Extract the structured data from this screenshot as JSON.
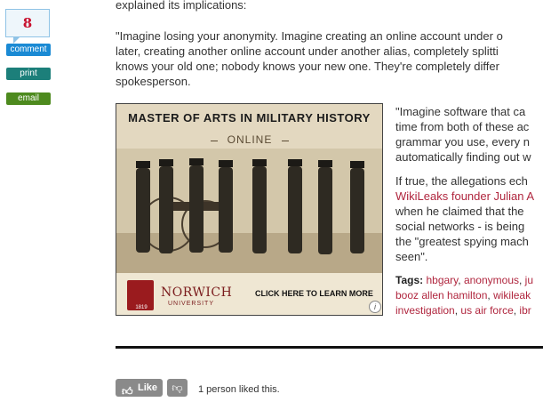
{
  "sidebar": {
    "comment_count": "8",
    "comment_label": "comment",
    "print_label": "print",
    "email_label": "email"
  },
  "article": {
    "intro_fragment": "explained its implications:",
    "quote_lines": [
      "\"Imagine losing your anonymity. Imagine creating an online account under o",
      "later, creating another online account under another alias, completely splitti",
      "knows your old one; nobody knows your new one. They're completely differ",
      "spokesperson."
    ],
    "right_para1": [
      "\"Imagine software that ca",
      "time from both of these ac",
      "grammar you use, every n",
      "automatically finding out w"
    ],
    "right_para2_line1": "If true, the allegations ech",
    "right_para2_link": "WikiLeaks founder Julian A",
    "right_para2_rest": [
      "when he claimed that the",
      "social networks - is being",
      "the \"greatest spying mach",
      "seen\"."
    ],
    "tags_label": "Tags:",
    "tags_row1": [
      "hbgary",
      "anonymous",
      "ju"
    ],
    "tags_row2": [
      "booz allen hamilton",
      "wikileak"
    ],
    "tags_row3": [
      "investigation",
      "us air force",
      "ibr"
    ]
  },
  "ad": {
    "title": "MASTER OF ARTS IN MILITARY HISTORY",
    "subtitle": "ONLINE",
    "brand": "NORWICH",
    "brand_sub": "UNIVERSITY",
    "logo_year": "1819",
    "cta": "CLICK HERE TO LEARN MORE",
    "info_icon": "i"
  },
  "social": {
    "like_label": "Like",
    "like_count_text": "1 person liked this."
  },
  "colors": {
    "accent_red": "#b0263e",
    "comment_blue": "#1a8ad4",
    "print_teal": "#1c7f7a",
    "email_green": "#4d8a1e"
  }
}
